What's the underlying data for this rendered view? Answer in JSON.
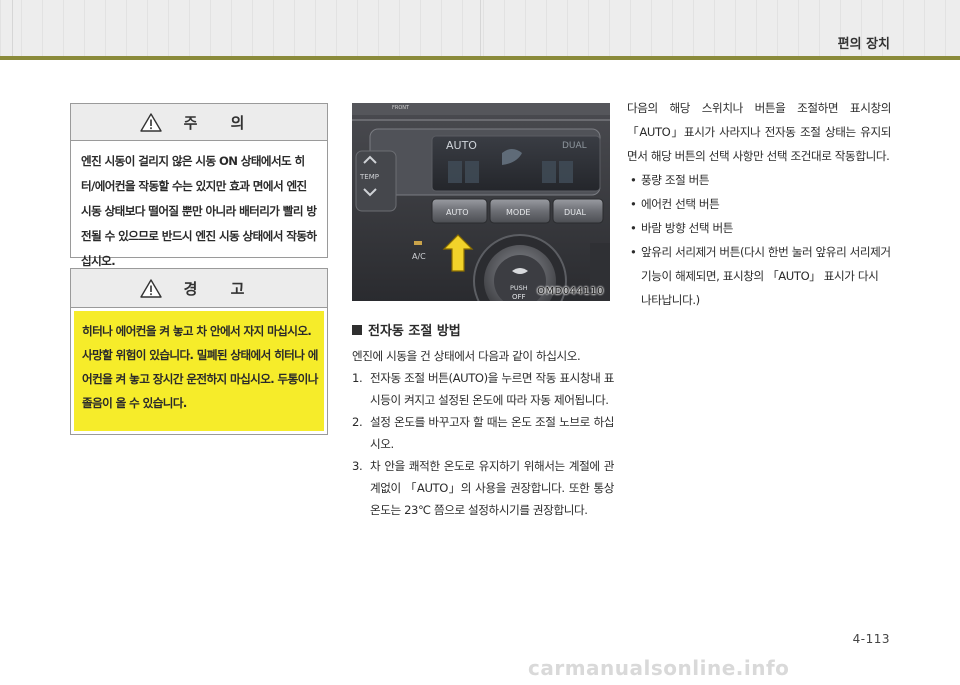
{
  "header": {
    "section_title": "편의 장치"
  },
  "caution": {
    "title": "주 의",
    "body": "엔진 시동이 걸리지 않은 시동 ON 상태에서도 히터/에어컨을 작동할 수는 있지만 효과 면에서 엔진 시동 상태보다 떨어질 뿐만 아니라 배터리가 빨리 방전될 수 있으므로 반드시 엔진 시동 상태에서 작동하십시오."
  },
  "warning": {
    "title": "경 고",
    "body": "히터나 에어컨을 켜 놓고 차 안에서 자지 마십시오. 사망할 위험이 있습니다. 밀폐된 상태에서 히터나 에어컨을 켜 놓고 장시간 운전하지 마십시오. 두통이나 졸음이 올 수 있습니다."
  },
  "photo": {
    "code": "OMD044110",
    "labels": {
      "front": "FRONT",
      "display_auto": "AUTO",
      "display_dual": "DUAL",
      "temp": "TEMP",
      "btn_auto": "AUTO",
      "btn_mode": "MODE",
      "btn_dual": "DUAL",
      "ac": "A/C",
      "push": "PUSH",
      "off": "OFF"
    }
  },
  "auto_control": {
    "heading": "전자동 조절 방법",
    "intro": "엔진에 시동을 건 상태에서 다음과 같이 하십시오.",
    "steps": [
      {
        "num": "1.",
        "text": "전자동 조절 버튼(AUTO)을 누르면 작동 표시창내 표시등이 켜지고 설정된 온도에 따라 자동 제어됩니다."
      },
      {
        "num": "2.",
        "text": "설정 온도를 바꾸고자 할 때는 온도 조절 노브로 하십시오."
      },
      {
        "num": "3.",
        "text": "차 안을 쾌적한 온도로 유지하기 위해서는 계절에 관계없이 「AUTO」의 사용을 권장합니다. 또한 통상 온도는 23℃ 쯤으로 설정하시기를 권장합니다."
      }
    ]
  },
  "right_column": {
    "intro": "다음의 해당 스위치나 버튼을 조절하면 표시창의 「AUTO」표시가 사라지나 전자동 조절 상태는 유지되면서 해당 버튼의 선택 사항만 선택 조건대로 작동합니다.",
    "bullets": [
      "풍량 조절 버튼",
      "에어컨 선택 버튼",
      "바람 방향 선택 버튼",
      "앞유리 서리제거 버튼(다시 한번 눌러 앞유리 서리제거 기능이 해제되면, 표시창의 「AUTO」 표시가 다시 나타납니다.)"
    ]
  },
  "footer": {
    "page_number": "4-113",
    "watermark": "carmanualsonline.info"
  }
}
